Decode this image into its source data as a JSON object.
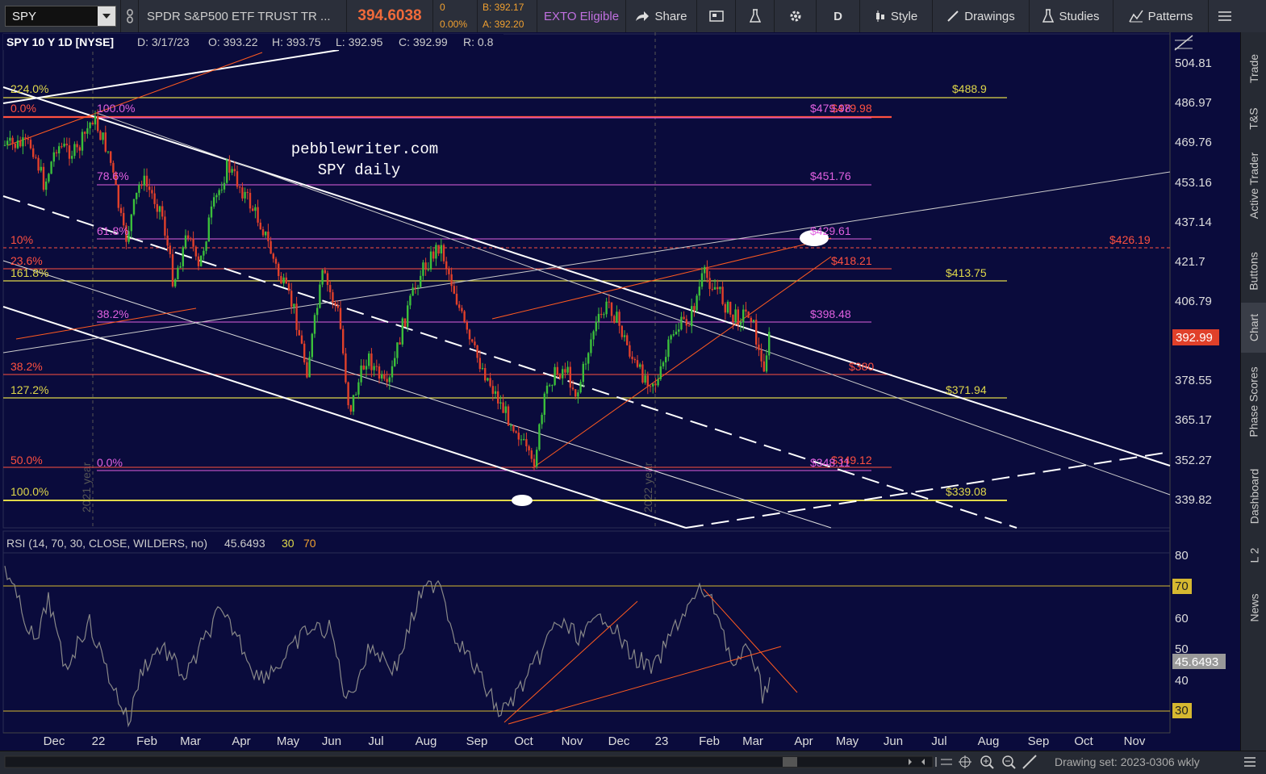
{
  "toolbar": {
    "symbol": "SPY",
    "description": "SPDR S&P500 ETF TRUST TR ...",
    "last_price": "394.6038",
    "change": "0",
    "change_pct": "0.00%",
    "bid": "B: 392.17",
    "ask": "A: 392.20",
    "exto": "EXTO Eligible",
    "share": "Share",
    "period": "D",
    "style": "Style",
    "drawings": "Drawings",
    "studies": "Studies",
    "patterns": "Patterns"
  },
  "chart": {
    "header": "SPY 10 Y 1D [NYSE]",
    "ohlc": {
      "d": "D: 3/17/23",
      "o": "O: 393.22",
      "h": "H: 393.75",
      "l": "L: 392.95",
      "c": "C: 392.99",
      "r": "R: 0.8"
    },
    "watermark_line1": "pebblewriter.com",
    "watermark_line2": "SPY daily",
    "price_axis": [
      "504.81",
      "486.97",
      "469.76",
      "453.16",
      "437.14",
      "421.7",
      "406.79",
      "392.99",
      "378.55",
      "365.17",
      "352.27",
      "339.82"
    ],
    "current_price_badge": "392.99",
    "left_labels": [
      "224.0%",
      "0.0%",
      "100.0%",
      "78.6%",
      "61.8%",
      "10%",
      "23.6%",
      "161.8%",
      "38.2%",
      "38.2%",
      "127.2%",
      "50.0%",
      "0.0%",
      "100.0%"
    ],
    "right_labels": [
      "$488.9",
      "$479.98",
      "$479.98",
      "$451.76",
      "$429.61",
      "$426.19",
      "$418.21",
      "$413.75",
      "$398.48",
      "$380",
      "$371.94",
      "$349.12",
      "$348.11",
      "$339.08"
    ],
    "year_labels": [
      "2021 year",
      "2022 year"
    ],
    "x_axis": [
      "Dec",
      "22",
      "Feb",
      "Mar",
      "Apr",
      "May",
      "Jun",
      "Jul",
      "Aug",
      "Sep",
      "Oct",
      "Nov",
      "Dec",
      "23",
      "Feb",
      "Mar",
      "Apr",
      "May",
      "Jun",
      "Jul",
      "Aug",
      "Sep",
      "Oct",
      "Nov"
    ],
    "colors": {
      "background": "#0a0b3c",
      "candle_up": "#3bbf3b",
      "candle_down": "#e0402a",
      "fib_yellow": "#e0d84a",
      "fib_magenta": "#e060e0",
      "fib_red": "#ff5040",
      "trend_white": "#ffffff",
      "trend_orange": "#ff5a20"
    }
  },
  "rsi": {
    "header": "RSI (14, 70, 30, CLOSE, WILDERS, no)",
    "value": "45.6493",
    "ob": "30",
    "os": "70",
    "axis": [
      "80",
      "70",
      "60",
      "50",
      "40",
      "30"
    ],
    "badge_70": "70",
    "badge_30": "30",
    "badge_value": "45.6493"
  },
  "sidebar": [
    "Trade",
    "T&S",
    "Active Trader",
    "Buttons",
    "Chart",
    "Phase Scores",
    "Dashboard",
    "L 2",
    "News"
  ],
  "bottom": {
    "drawing_set": "Drawing set: 2023-0306 wkly"
  }
}
